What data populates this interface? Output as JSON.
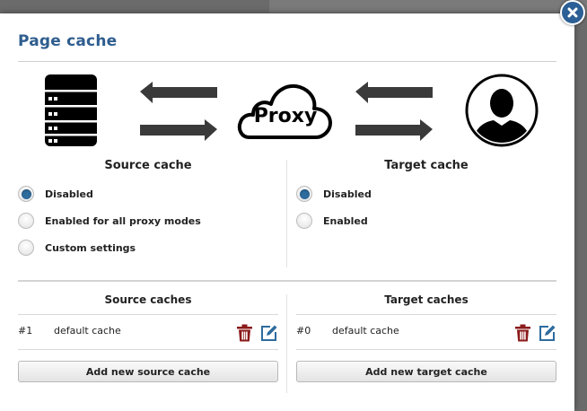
{
  "dialog": {
    "title": "Page cache",
    "proxy_label": "Proxy"
  },
  "source": {
    "heading": "Source cache",
    "options": [
      "Disabled",
      "Enabled for all proxy modes",
      "Custom settings"
    ],
    "selected": "Disabled"
  },
  "target": {
    "heading": "Target cache",
    "options": [
      "Disabled",
      "Enabled"
    ],
    "selected": "Disabled"
  },
  "source_caches": {
    "heading": "Source caches",
    "rows": [
      {
        "id": "#1",
        "name": "default cache"
      }
    ],
    "add_label": "Add new source cache"
  },
  "target_caches": {
    "heading": "Target caches",
    "rows": [
      {
        "id": "#0",
        "name": "default cache"
      }
    ],
    "add_label": "Add new target cache"
  },
  "colors": {
    "accent": "#2e5d8e",
    "delete_icon": "#8b1a1a",
    "edit_icon": "#2e6c9e"
  }
}
